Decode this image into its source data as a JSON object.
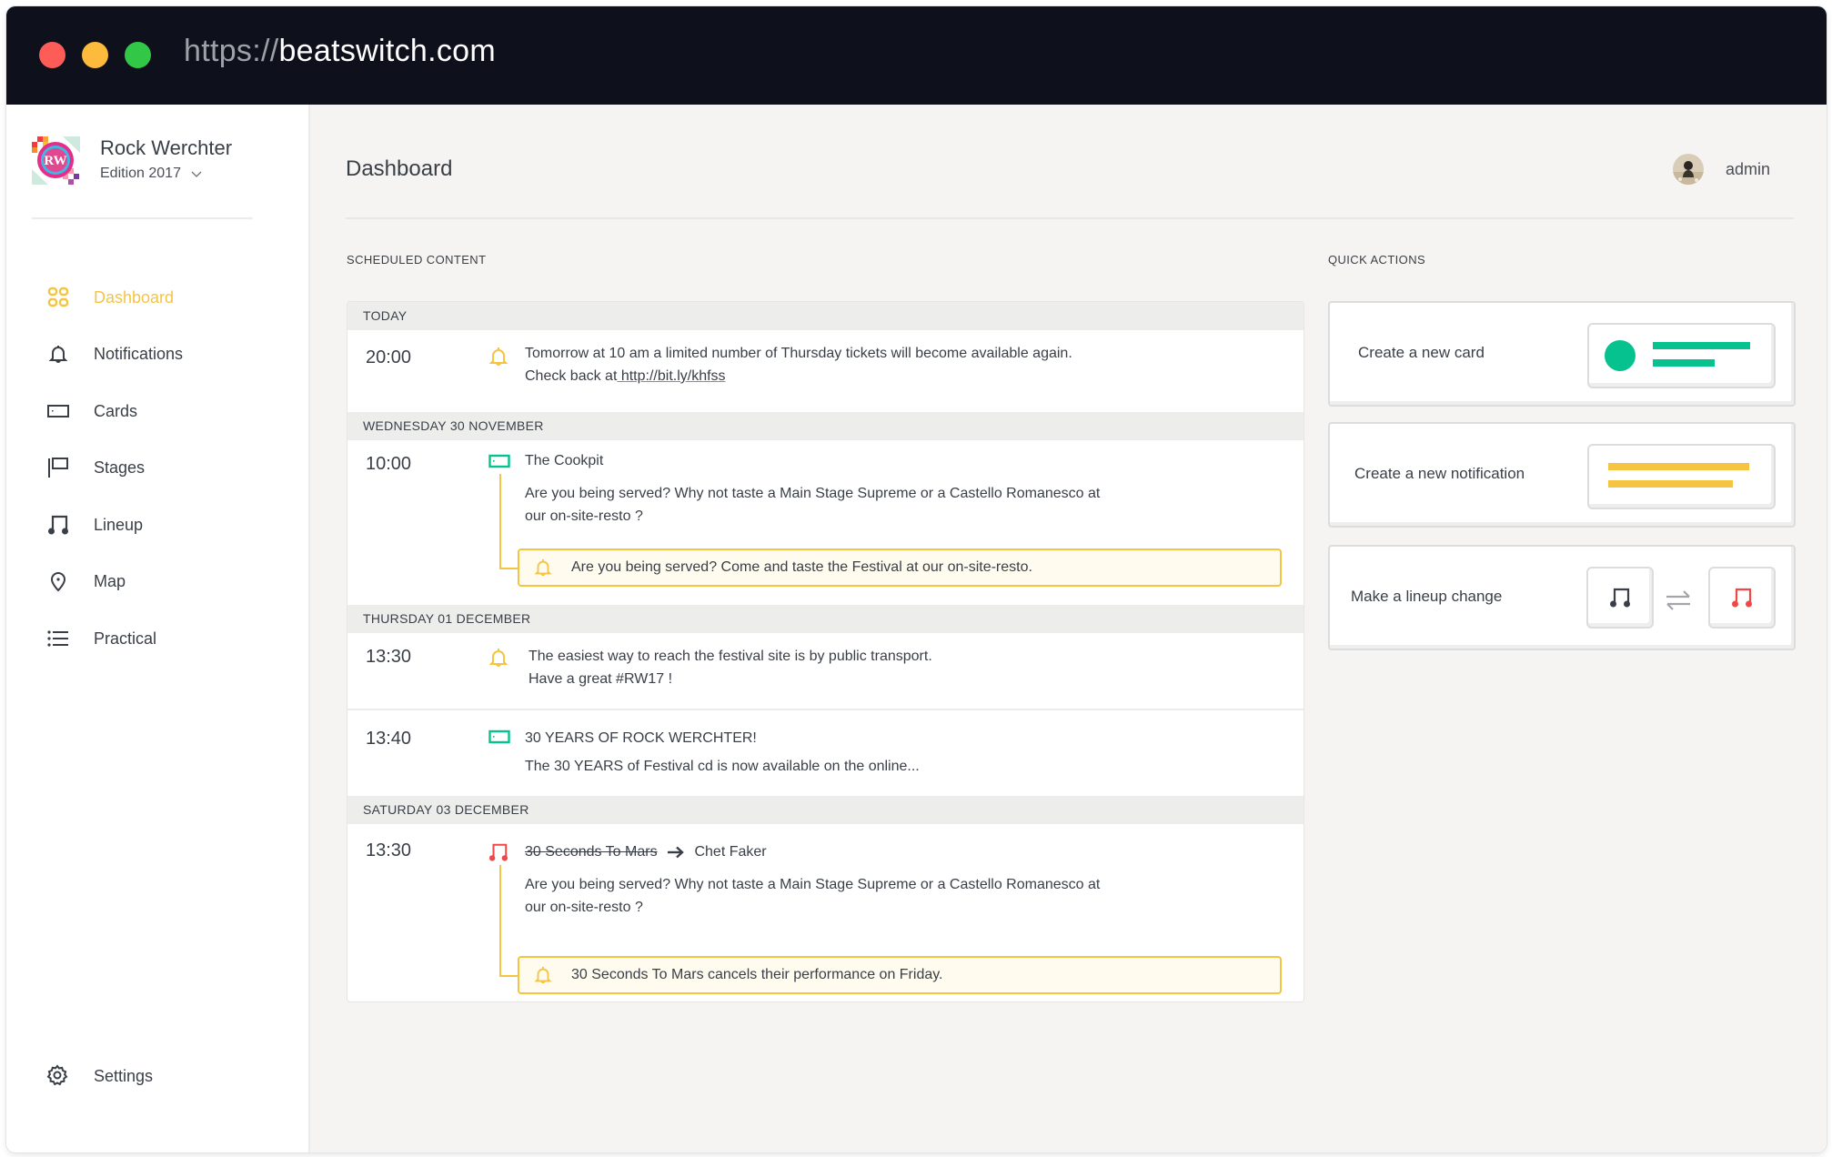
{
  "browser": {
    "url_scheme": "https://",
    "url_host": "beatswitch.com"
  },
  "sidebar": {
    "brand_name": "Rock Werchter",
    "edition": "Edition 2017",
    "logo_initials": "RW",
    "items": [
      {
        "label": "Dashboard",
        "icon": "grid-icon",
        "active": true
      },
      {
        "label": "Notifications",
        "icon": "bell-icon",
        "active": false
      },
      {
        "label": "Cards",
        "icon": "card-icon",
        "active": false
      },
      {
        "label": "Stages",
        "icon": "flag-icon",
        "active": false
      },
      {
        "label": "Lineup",
        "icon": "music-note-icon",
        "active": false
      },
      {
        "label": "Map",
        "icon": "map-pin-icon",
        "active": false
      },
      {
        "label": "Practical",
        "icon": "list-icon",
        "active": false
      }
    ],
    "settings_label": "Settings"
  },
  "header": {
    "title": "Dashboard",
    "username": "admin"
  },
  "scheduled": {
    "section_label": "SCHEDULED CONTENT",
    "days": [
      {
        "label": "TODAY",
        "entries": [
          {
            "time": "20:00",
            "type": "notification",
            "line1": "Tomorrow at 10 am a limited number of Thursday tickets will become available again.",
            "line2_prefix": "Check back at",
            "line2_link": " http://bit.ly/khfss"
          }
        ]
      },
      {
        "label": "WEDNESDAY 30 NOVEMBER",
        "entries": [
          {
            "time": "10:00",
            "type": "card",
            "title": "The Cookpit",
            "line1": "Are you being served? Why not taste a Main Stage Supreme or a Castello Romanesco at",
            "line2": "our on-site-resto ?",
            "linked_notification": "Are you being served? Come and taste the Festival at our on-site-resto."
          }
        ]
      },
      {
        "label": "THURSDAY 01 DECEMBER",
        "entries": [
          {
            "time": "13:30",
            "type": "notification",
            "line1": "The easiest way to reach the festival site is by public transport.",
            "line2": "Have a great #RW17 !"
          },
          {
            "time": "13:40",
            "type": "card",
            "title": "30 YEARS OF ROCK WERCHTER!",
            "line1": "The 30 YEARS of Festival cd is now available  on the online..."
          }
        ]
      },
      {
        "label": "SATURDAY 03 DECEMBER",
        "entries": [
          {
            "time": "13:30",
            "type": "lineup-change",
            "from_artist": "30 Seconds To Mars",
            "to_artist": "Chet Faker",
            "line1": "Are you being served? Why not taste a Main Stage Supreme or a Castello Romanesco at",
            "line2": "our on-site-resto ?",
            "linked_notification": "30 Seconds To Mars cancels their performance on Friday."
          }
        ]
      }
    ]
  },
  "quick_actions": {
    "section_label": "QUICK ACTIONS",
    "items": [
      {
        "label": "Create a new card",
        "visual": "card-preview"
      },
      {
        "label": "Create a new notification",
        "visual": "notification-preview"
      },
      {
        "label": "Make a lineup change",
        "visual": "lineup-swap"
      }
    ]
  },
  "colors": {
    "accent_yellow": "#f5c443",
    "card_green": "#05c28f",
    "lineup_red": "#f04848",
    "titlebar": "#0e111c",
    "text": "#3a3f47"
  }
}
